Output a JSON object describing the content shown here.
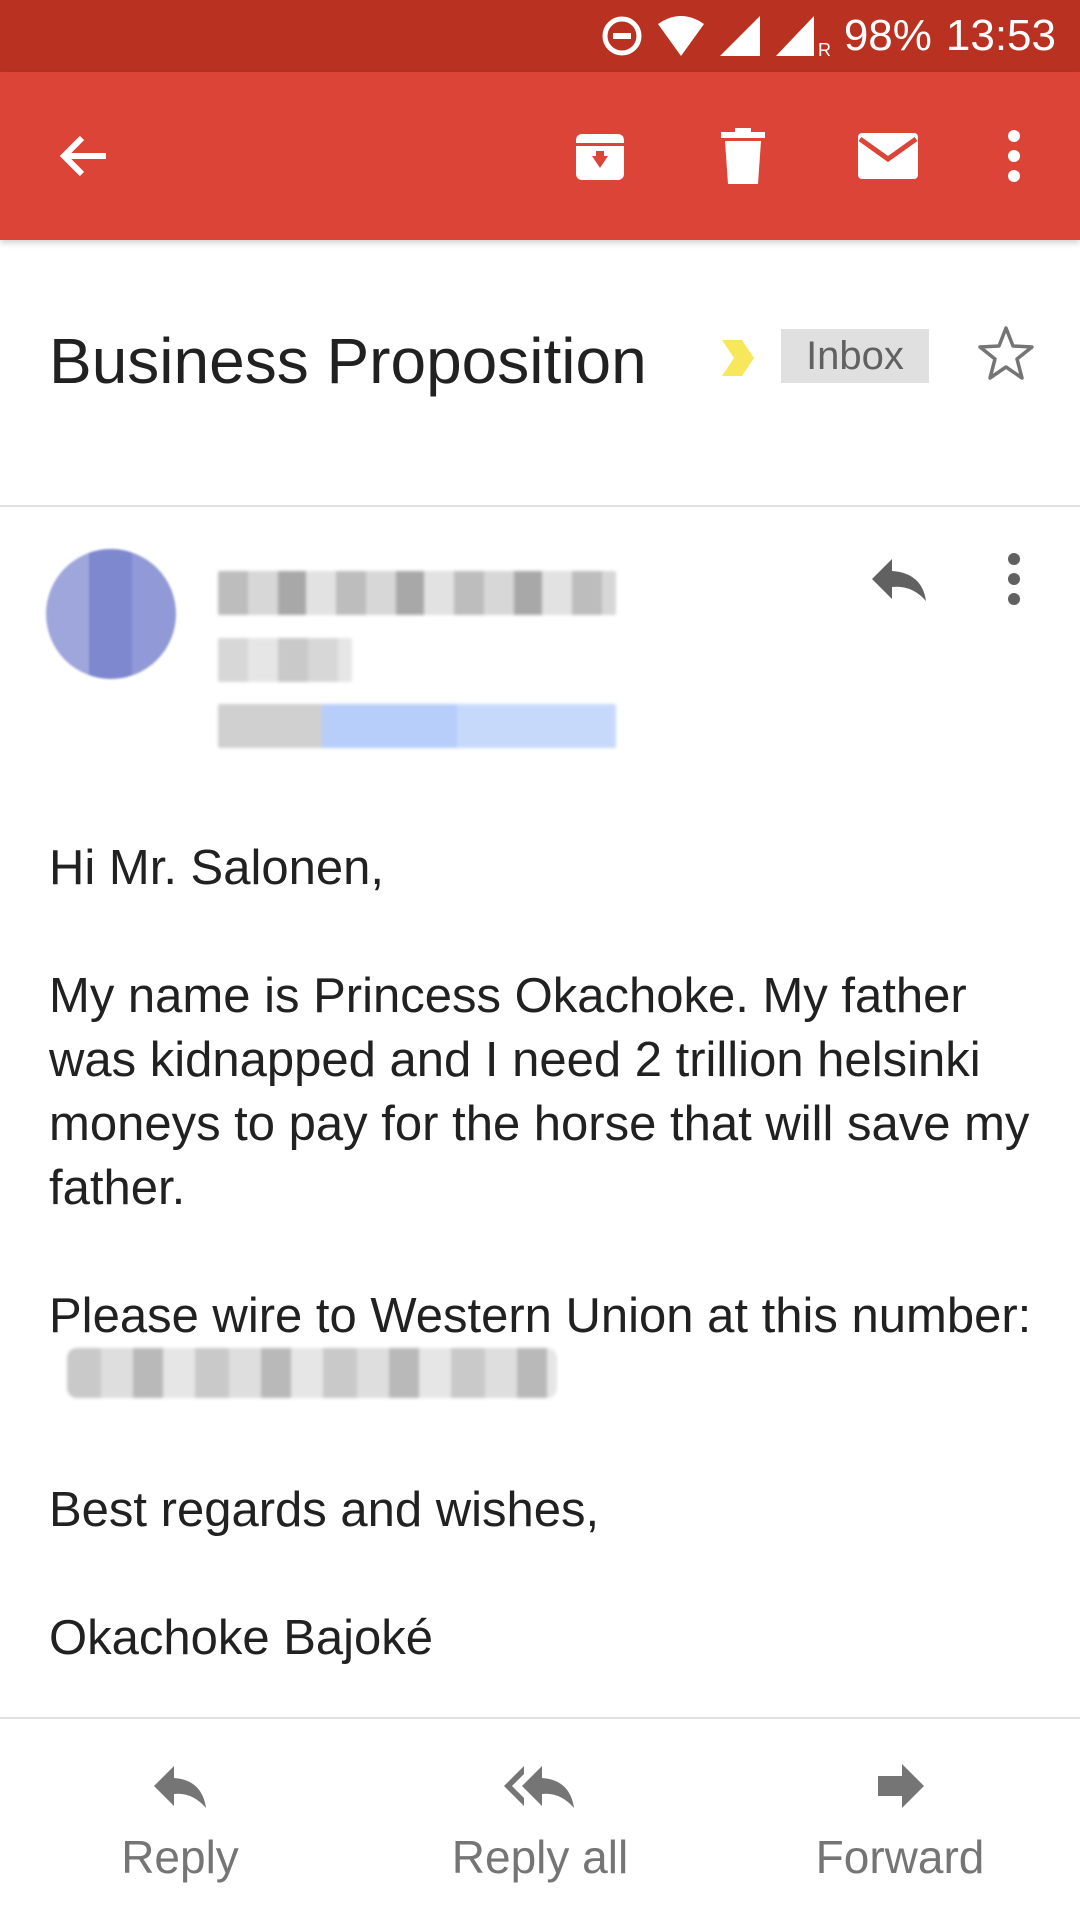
{
  "status_bar": {
    "battery": "98%",
    "time": "13:53",
    "icons": [
      "do-not-disturb-icon",
      "wifi-icon",
      "signal-icon",
      "signal-roaming-icon"
    ]
  },
  "toolbar": {
    "icons": [
      "back-arrow-icon",
      "archive-icon",
      "delete-icon",
      "mark-unread-icon",
      "more-vert-icon"
    ]
  },
  "email": {
    "subject": "Business Proposition",
    "label": "Inbox",
    "body": {
      "greeting": "Hi Mr. Salonen,",
      "paragraph1": "My name is Princess Okachoke. My father was kidnapped and I need 2 trillion helsinki moneys to pay for the horse that will save my father.",
      "paragraph2_prefix": "Please wire to Western Union at this number:",
      "closing": "Best regards and wishes,",
      "signature": "Okachoke Bajoké"
    }
  },
  "actions": {
    "reply": "Reply",
    "reply_all": "Reply all",
    "forward": "Forward"
  },
  "colors": {
    "status_bar": "#b93221",
    "toolbar": "#db4437",
    "label_arrow": "#f6e75b",
    "avatar": "#7e88cf"
  }
}
